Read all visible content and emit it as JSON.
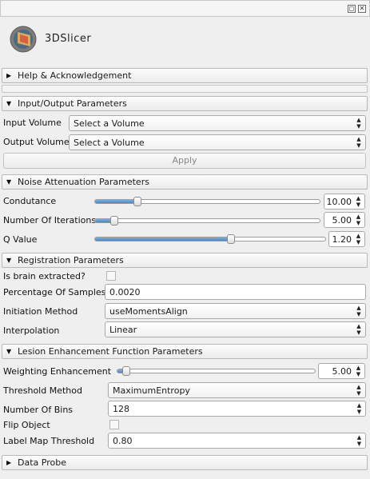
{
  "window": {
    "float_icon": "float-icon",
    "close_icon": "close-icon"
  },
  "logo": {
    "text": "3DSlicer",
    "icon": "slicer-logo-icon"
  },
  "sections": {
    "help": "Help & Acknowledgement",
    "io": "Input/Output Parameters",
    "noise": "Noise Attenuation Parameters",
    "registration": "Registration Parameters",
    "lesion": "Lesion Enhancement Function Parameters",
    "probe": "Data Probe"
  },
  "io": {
    "input_label": "Input Volume",
    "input_value": "Select a Volume",
    "output_label": "Output Volume",
    "output_value": "Select a Volume",
    "apply_label": "Apply"
  },
  "noise": {
    "condutance_label": "Condutance",
    "condutance_value": "10.00",
    "condutance_level": 0.19,
    "iterations_label": "Number Of Iterations",
    "iterations_value": "5.00",
    "iterations_level": 0.09,
    "q_label": "Q Value",
    "q_value": "1.20",
    "q_level": 0.59
  },
  "registration": {
    "brain_label": "Is brain extracted?",
    "brain_checked": false,
    "samples_label": "Percentage Of Samples",
    "samples_value": "0.0020",
    "init_label": "Initiation Method",
    "init_value": "useMomentsAlign",
    "interp_label": "Interpolation",
    "interp_value": "Linear"
  },
  "lesion": {
    "weighting_label": "Weighting Enhancement",
    "weighting_value": "5.00",
    "weighting_level": 0.05,
    "threshold_label": "Threshold Method",
    "threshold_value": "MaximumEntropy",
    "bins_label": "Number Of Bins",
    "bins_value": "128",
    "flip_label": "Flip Object",
    "flip_checked": false,
    "labelmap_label": "Label Map Threshold",
    "labelmap_value": "0.80"
  },
  "colors": {
    "accent": "#4a86c2"
  }
}
